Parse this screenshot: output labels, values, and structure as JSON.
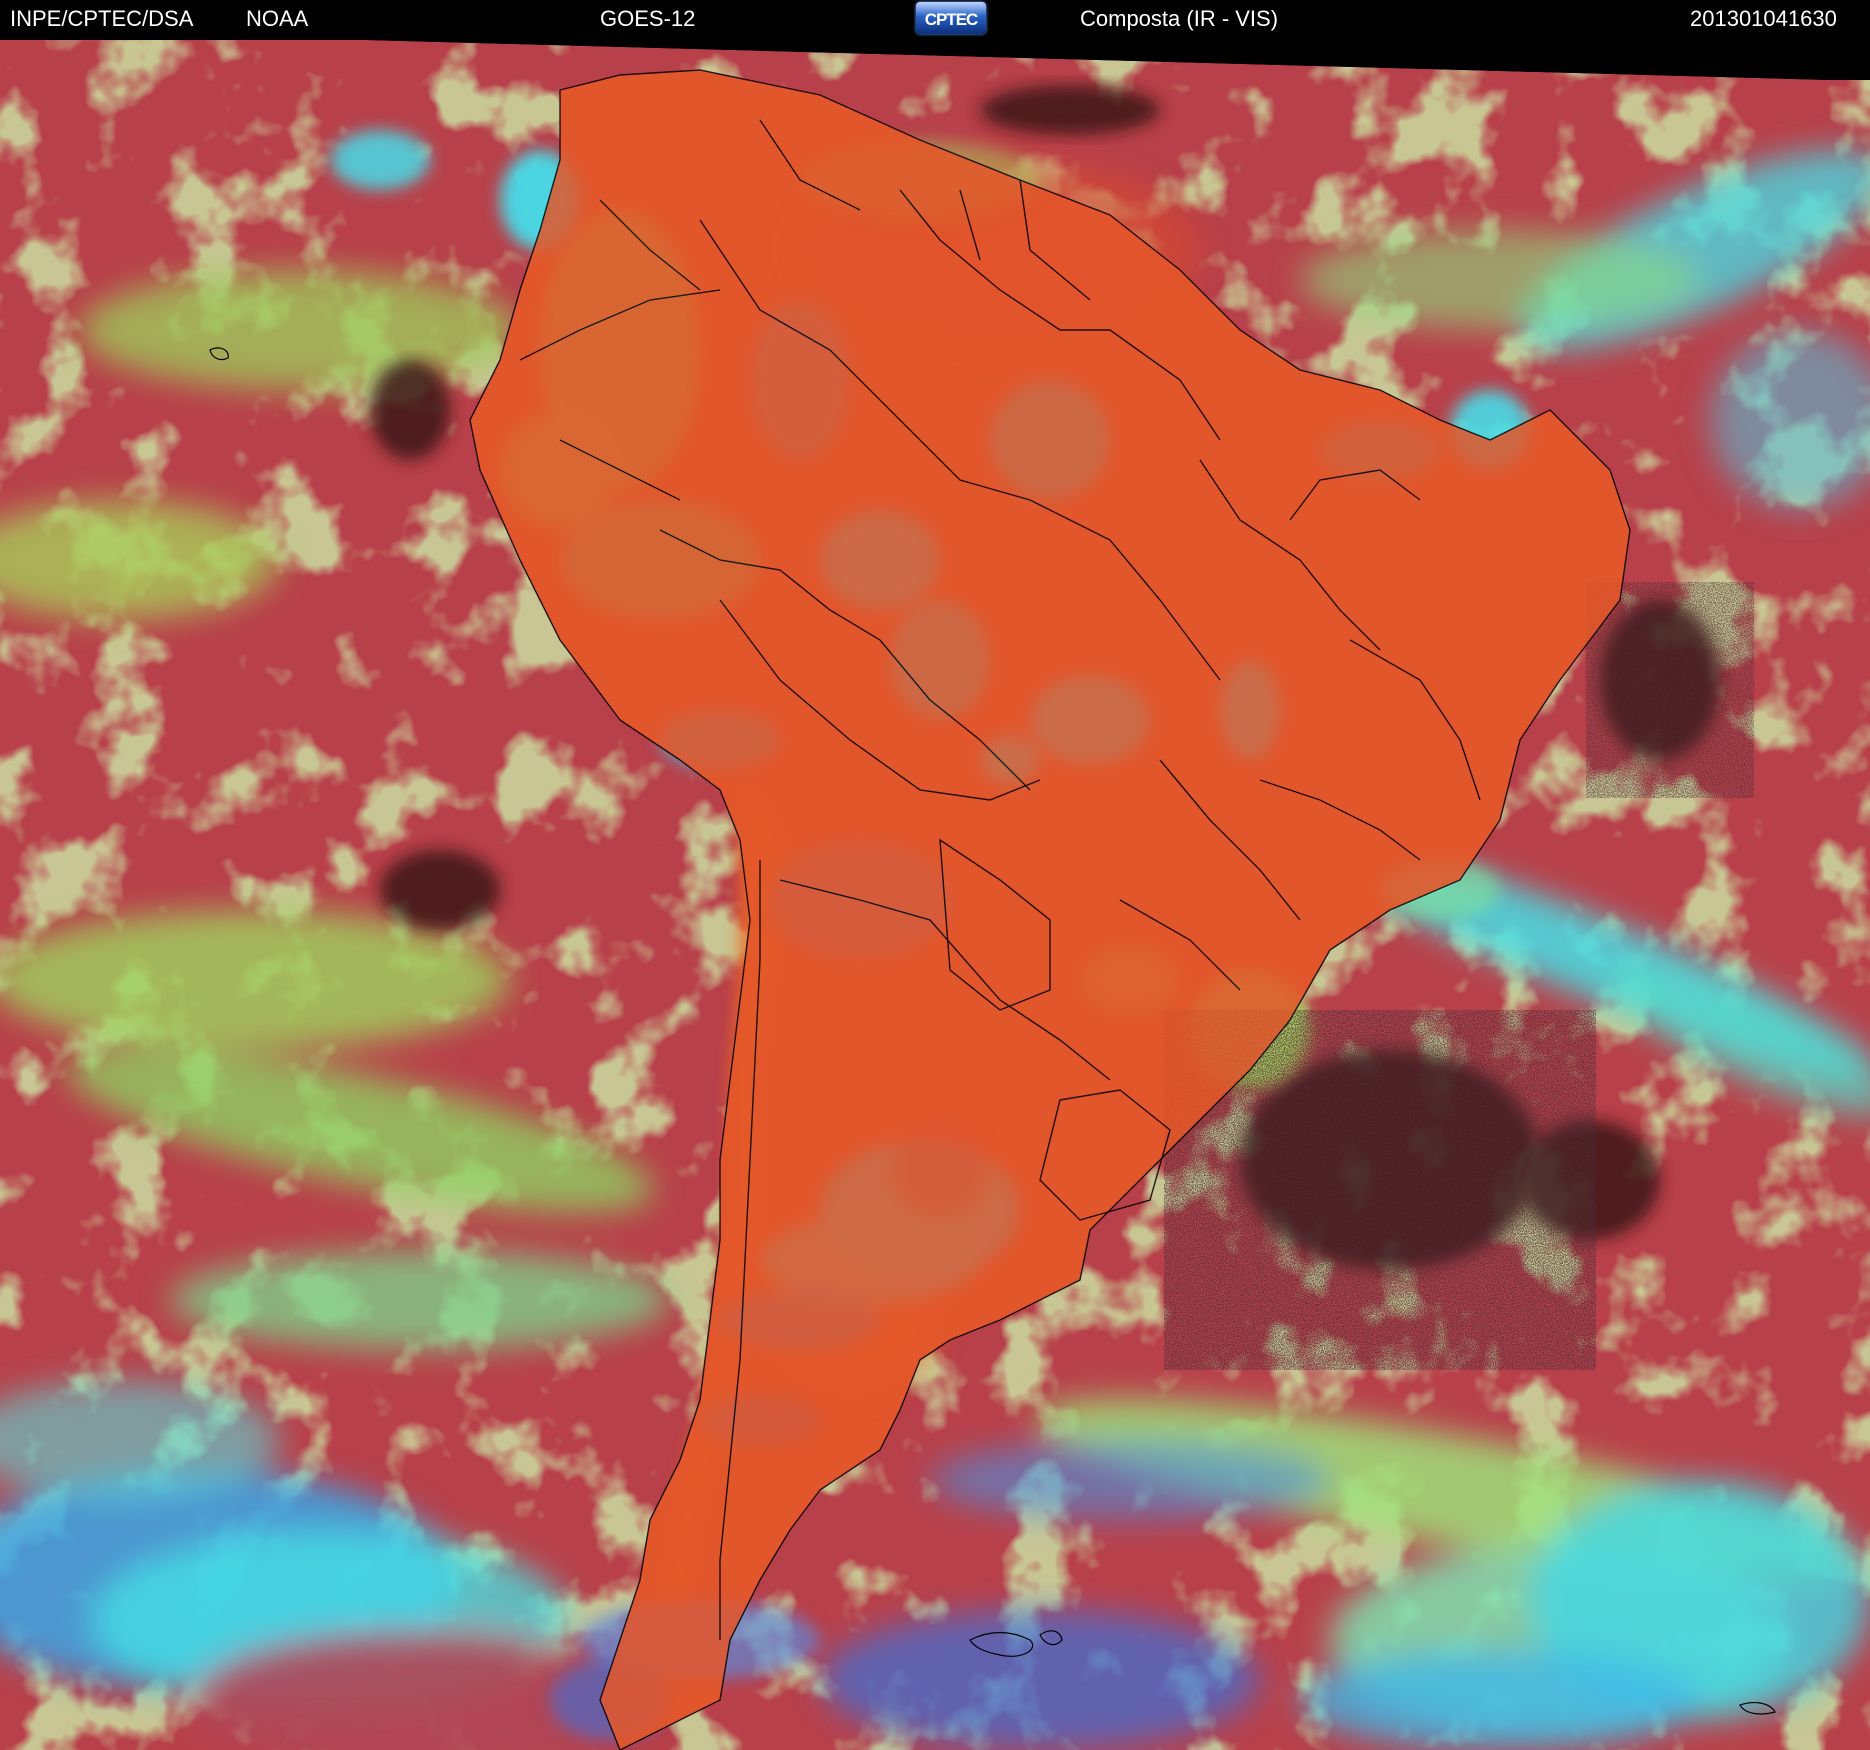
{
  "header": {
    "agency": "INPE/CPTEC/DSA",
    "source": "NOAA",
    "satellite": "GOES-12",
    "logo_text": "CPTEC",
    "product": "Composta (IR - VIS)",
    "timestamp": "201301041630"
  },
  "colors": {
    "ocean": "#b8404a",
    "land": "#e55a2a",
    "cloud_cyan": "#39e6f0",
    "cloud_green": "#9fe86a",
    "clear_dark": "#1c0f12",
    "border_lines": "#000000"
  }
}
